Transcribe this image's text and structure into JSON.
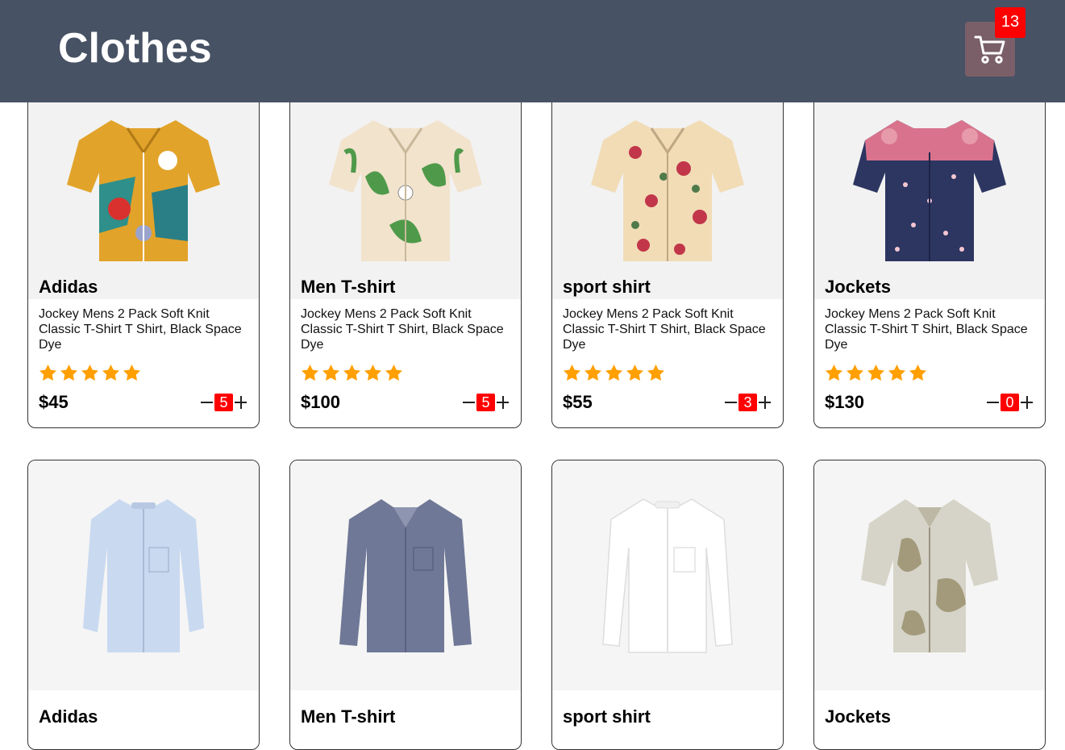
{
  "header": {
    "title": "Clothes",
    "cart_count": "13"
  },
  "colors": {
    "header_bg": "#475264",
    "cart_button_bg": "#7a5f68",
    "badge_red": "#ff0000",
    "star": "#ff9f00"
  },
  "products": [
    {
      "name": "Adidas",
      "description": "Jockey Mens 2 Pack Soft Knit Classic T-Shirt T Shirt, Black Space Dye",
      "rating": 5,
      "price": "$45",
      "quantity": "5",
      "image": "colorful-floral-shirt"
    },
    {
      "name": "Men T-shirt",
      "description": "Jockey Mens 2 Pack Soft Knit Classic T-Shirt T Shirt, Black Space Dye",
      "rating": 5,
      "price": "$100",
      "quantity": "5",
      "image": "lily-print-shirt"
    },
    {
      "name": "sport shirt",
      "description": "Jockey Mens 2 Pack Soft Knit Classic T-Shirt T Shirt, Black Space Dye",
      "rating": 5,
      "price": "$55",
      "quantity": "3",
      "image": "rose-print-shirt"
    },
    {
      "name": "Jockets",
      "description": "Jockey Mens 2 Pack Soft Knit Classic T-Shirt T Shirt, Black Space Dye",
      "rating": 5,
      "price": "$130",
      "quantity": "0",
      "image": "navy-floral-shirt"
    },
    {
      "name": "Adidas",
      "image": "light-blue-long-sleeve-shirt"
    },
    {
      "name": "Men T-shirt",
      "image": "navy-gingham-long-sleeve-shirt"
    },
    {
      "name": "sport shirt",
      "image": "white-long-sleeve-shirt"
    },
    {
      "name": "Jockets",
      "image": "khaki-print-short-sleeve-shirt"
    }
  ]
}
